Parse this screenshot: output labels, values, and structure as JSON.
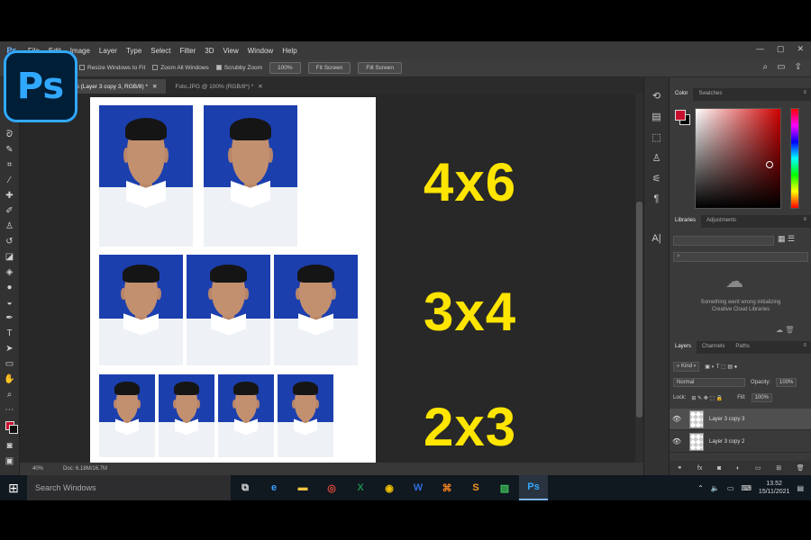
{
  "app": {
    "logo_text": "Ps",
    "menu_logo": "Ps",
    "menu": [
      "File",
      "Edit",
      "Image",
      "Layer",
      "Type",
      "Select",
      "Filter",
      "3D",
      "View",
      "Window",
      "Help"
    ],
    "window_controls": [
      "—",
      "▢",
      "✕"
    ]
  },
  "options_bar": {
    "resize_windows": "Resize Windows to Fit",
    "zoom_all": "Zoom All Windows",
    "scrubby_zoom": "Scrubby Zoom",
    "zoom_100": "100%",
    "fit_screen": "Fit Screen",
    "fill_screen": "Fill Screen"
  },
  "doc_tabs": [
    {
      "label": "% (Layer 3 copy 3, RGB/8) *",
      "close": "✕",
      "active": true
    },
    {
      "label": "Foto.JPG @ 100% (RGB/8*) *",
      "close": "✕",
      "active": false
    }
  ],
  "canvas": {
    "labels": [
      "4x6",
      "3x4",
      "2x3"
    ]
  },
  "status": {
    "zoom": "40%",
    "doc": "Doc: 6.18M/16.7M"
  },
  "panels": {
    "color_tabs": [
      "Color",
      "Swatches"
    ],
    "library_tabs": [
      "Libraries",
      "Adjustments"
    ],
    "library_message_1": "Something went wrong initializing",
    "library_message_2": "Creative Cloud Libraries",
    "layers_tabs": [
      "Layers",
      "Channels",
      "Paths"
    ],
    "kind_filter": "Kind",
    "blend_mode": "Normal",
    "opacity_label": "Opacity:",
    "opacity_value": "100%",
    "lock_label": "Lock:",
    "fill_label": "Fill:",
    "fill_value": "100%",
    "layers": [
      {
        "name": "Layer 3 copy 3",
        "selected": true
      },
      {
        "name": "Layer 3 copy 2",
        "selected": false
      }
    ]
  },
  "taskbar": {
    "start_icon": "windows-logo",
    "search_placeholder": "Search Windows",
    "time": "13.52",
    "date": "15/11/2021"
  },
  "colors": {
    "label_yellow": "#ffe500",
    "photo_blue": "#1c3fae",
    "ps_blue": "#31a8ff",
    "ps_navy": "#001e36",
    "foreground_color": "#c8102e"
  }
}
